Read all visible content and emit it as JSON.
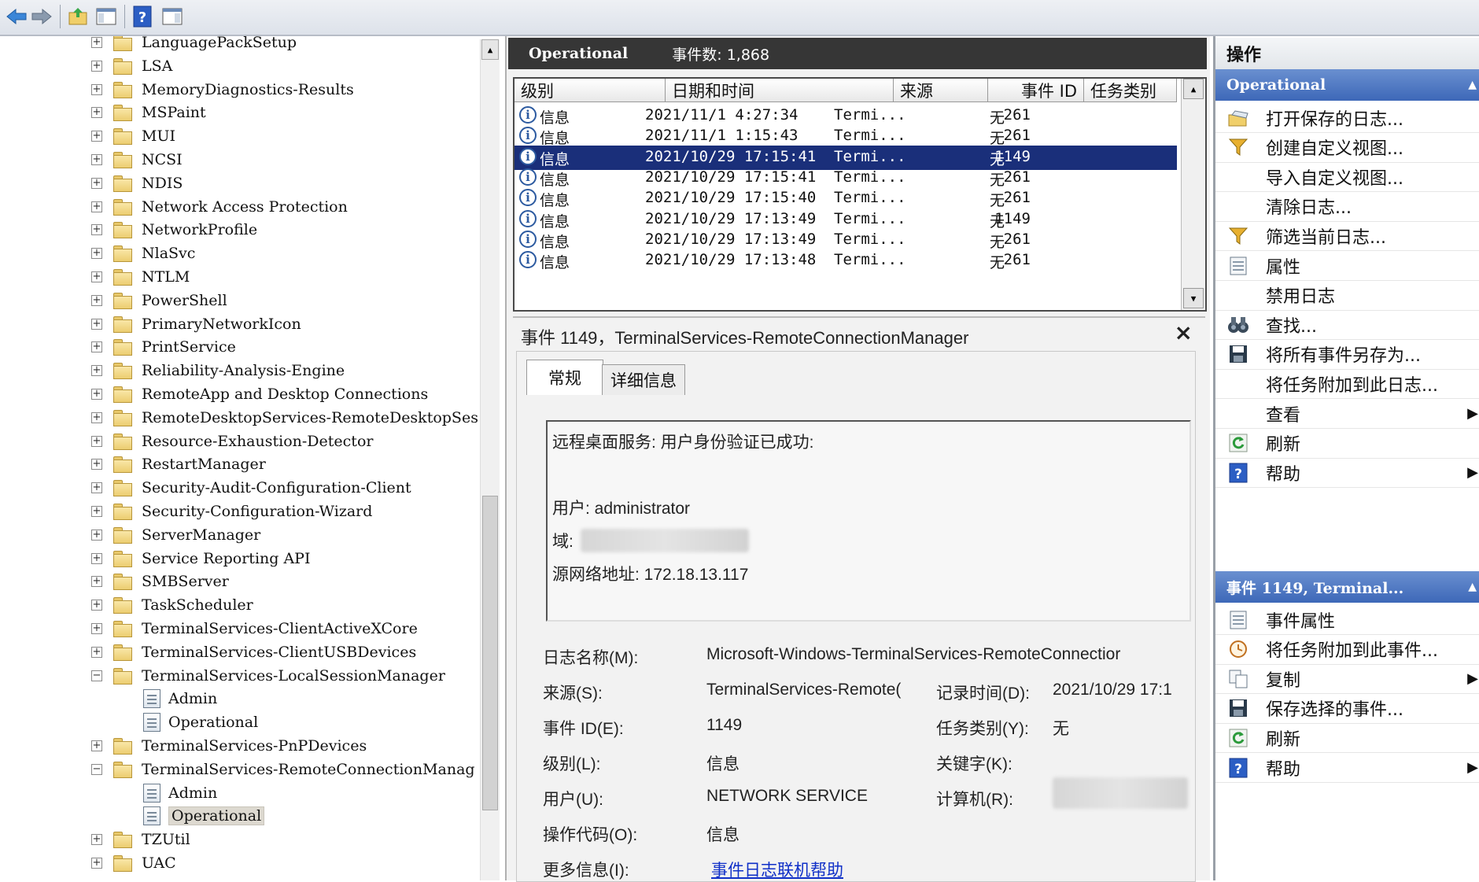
{
  "toolbar": {
    "buttons": [
      "back-icon",
      "forward-icon",
      "up-folder-icon",
      "show-hide-tree-icon",
      "help-icon",
      "show-hide-action-icon"
    ]
  },
  "tree": {
    "items": [
      {
        "label": "LanguagePackSetup",
        "type": "folder",
        "exp": "+"
      },
      {
        "label": "LSA",
        "type": "folder",
        "exp": "+"
      },
      {
        "label": "MemoryDiagnostics-Results",
        "type": "folder",
        "exp": "+"
      },
      {
        "label": "MSPaint",
        "type": "folder",
        "exp": "+"
      },
      {
        "label": "MUI",
        "type": "folder",
        "exp": "+"
      },
      {
        "label": "NCSI",
        "type": "folder",
        "exp": "+"
      },
      {
        "label": "NDIS",
        "type": "folder",
        "exp": "+"
      },
      {
        "label": "Network Access Protection",
        "type": "folder",
        "exp": "+"
      },
      {
        "label": "NetworkProfile",
        "type": "folder",
        "exp": "+"
      },
      {
        "label": "NlaSvc",
        "type": "folder",
        "exp": "+"
      },
      {
        "label": "NTLM",
        "type": "folder",
        "exp": "+"
      },
      {
        "label": "PowerShell",
        "type": "folder",
        "exp": "+"
      },
      {
        "label": "PrimaryNetworkIcon",
        "type": "folder",
        "exp": "+"
      },
      {
        "label": "PrintService",
        "type": "folder",
        "exp": "+"
      },
      {
        "label": "Reliability-Analysis-Engine",
        "type": "folder",
        "exp": "+"
      },
      {
        "label": "RemoteApp and Desktop Connections",
        "type": "folder",
        "exp": "+"
      },
      {
        "label": "RemoteDesktopServices-RemoteDesktopSes",
        "type": "folder",
        "exp": "+"
      },
      {
        "label": "Resource-Exhaustion-Detector",
        "type": "folder",
        "exp": "+"
      },
      {
        "label": "RestartManager",
        "type": "folder",
        "exp": "+"
      },
      {
        "label": "Security-Audit-Configuration-Client",
        "type": "folder",
        "exp": "+"
      },
      {
        "label": "Security-Configuration-Wizard",
        "type": "folder",
        "exp": "+"
      },
      {
        "label": "ServerManager",
        "type": "folder",
        "exp": "+"
      },
      {
        "label": "Service Reporting API",
        "type": "folder",
        "exp": "+"
      },
      {
        "label": "SMBServer",
        "type": "folder",
        "exp": "+"
      },
      {
        "label": "TaskScheduler",
        "type": "folder",
        "exp": "+"
      },
      {
        "label": "TerminalServices-ClientActiveXCore",
        "type": "folder",
        "exp": "+"
      },
      {
        "label": "TerminalServices-ClientUSBDevices",
        "type": "folder",
        "exp": "+"
      },
      {
        "label": "TerminalServices-LocalSessionManager",
        "type": "folder",
        "exp": "−"
      },
      {
        "label": "Admin",
        "type": "log-admin",
        "exp": ""
      },
      {
        "label": "Operational",
        "type": "log",
        "exp": ""
      },
      {
        "label": "TerminalServices-PnPDevices",
        "type": "folder",
        "exp": "+"
      },
      {
        "label": "TerminalServices-RemoteConnectionManag",
        "type": "folder",
        "exp": "−"
      },
      {
        "label": "Admin",
        "type": "log-admin",
        "exp": ""
      },
      {
        "label": "Operational",
        "type": "log",
        "exp": "",
        "selected": true
      },
      {
        "label": "TZUtil",
        "type": "folder",
        "exp": "+"
      },
      {
        "label": "UAC",
        "type": "folder",
        "exp": "+"
      }
    ]
  },
  "main": {
    "log_name": "Operational",
    "event_count": "事件数: 1,868",
    "columns": [
      "级别",
      "日期和时间",
      "来源",
      "事件 ID",
      "任务类别"
    ],
    "rows": [
      {
        "level": "信息",
        "datetime": "2021/11/1 4:27:34",
        "source": "Termi...",
        "id": "261",
        "task": "无"
      },
      {
        "level": "信息",
        "datetime": "2021/11/1 1:15:43",
        "source": "Termi...",
        "id": "261",
        "task": "无"
      },
      {
        "level": "信息",
        "datetime": "2021/10/29 17:15:41",
        "source": "Termi...",
        "id": "1149",
        "task": "无",
        "selected": true
      },
      {
        "level": "信息",
        "datetime": "2021/10/29 17:15:41",
        "source": "Termi...",
        "id": "261",
        "task": "无"
      },
      {
        "level": "信息",
        "datetime": "2021/10/29 17:15:40",
        "source": "Termi...",
        "id": "261",
        "task": "无"
      },
      {
        "level": "信息",
        "datetime": "2021/10/29 17:13:49",
        "source": "Termi...",
        "id": "1149",
        "task": "无"
      },
      {
        "level": "信息",
        "datetime": "2021/10/29 17:13:49",
        "source": "Termi...",
        "id": "261",
        "task": "无"
      },
      {
        "level": "信息",
        "datetime": "2021/10/29 17:13:48",
        "source": "Termi...",
        "id": "261",
        "task": "无"
      }
    ]
  },
  "detail": {
    "title": "事件 1149，TerminalServices-RemoteConnectionManager",
    "close": "×",
    "tabs": [
      "常规",
      "详细信息"
    ],
    "description": {
      "line1": "远程桌面服务: 用户身份验证已成功:",
      "user": "用户: administrator",
      "domain": "域:",
      "source_addr": "源网络地址: 172.18.13.117"
    },
    "props": {
      "log_name_label": "日志名称(M):",
      "log_name_value": "Microsoft-Windows-TerminalServices-RemoteConnectior",
      "source_label": "来源(S):",
      "source_value": "TerminalServices-Remote(",
      "logged_label": "记录时间(D):",
      "logged_value": "2021/10/29 17:1",
      "event_id_label": "事件 ID(E):",
      "event_id_value": "1149",
      "task_label": "任务类别(Y):",
      "task_value": "无",
      "level_label": "级别(L):",
      "level_value": "信息",
      "keywords_label": "关键字(K):",
      "user_label": "用户(U):",
      "user_value": "NETWORK SERVICE",
      "computer_label": "计算机(R):",
      "opcode_label": "操作代码(O):",
      "opcode_value": "信息",
      "more_info_label": "更多信息(I):",
      "more_info_link": "事件日志联机帮助"
    }
  },
  "actions": {
    "title": "操作",
    "section1": "Operational",
    "items1": [
      {
        "label": "打开保存的日志...",
        "icon": "open-folder-icon"
      },
      {
        "label": "创建自定义视图...",
        "icon": "filter-icon"
      },
      {
        "label": "导入自定义视图...",
        "icon": ""
      },
      {
        "label": "清除日志...",
        "icon": ""
      },
      {
        "label": "筛选当前日志...",
        "icon": "filter-icon"
      },
      {
        "label": "属性",
        "icon": "properties-icon"
      },
      {
        "label": "禁用日志",
        "icon": ""
      },
      {
        "label": "查找...",
        "icon": "binoculars-icon"
      },
      {
        "label": "将所有事件另存为...",
        "icon": "save-icon"
      },
      {
        "label": "将任务附加到此日志...",
        "icon": ""
      },
      {
        "label": "查看",
        "icon": "",
        "submenu": true
      },
      {
        "label": "刷新",
        "icon": "refresh-icon"
      },
      {
        "label": "帮助",
        "icon": "help-icon",
        "submenu": true
      }
    ],
    "section2": "事件 1149, Terminal...",
    "items2": [
      {
        "label": "事件属性",
        "icon": "properties-icon"
      },
      {
        "label": "将任务附加到此事件...",
        "icon": "task-icon"
      },
      {
        "label": "复制",
        "icon": "copy-icon",
        "submenu": true
      },
      {
        "label": "保存选择的事件...",
        "icon": "save-icon"
      },
      {
        "label": "刷新",
        "icon": "refresh-icon"
      },
      {
        "label": "帮助",
        "icon": "help-icon",
        "submenu": true
      }
    ]
  }
}
